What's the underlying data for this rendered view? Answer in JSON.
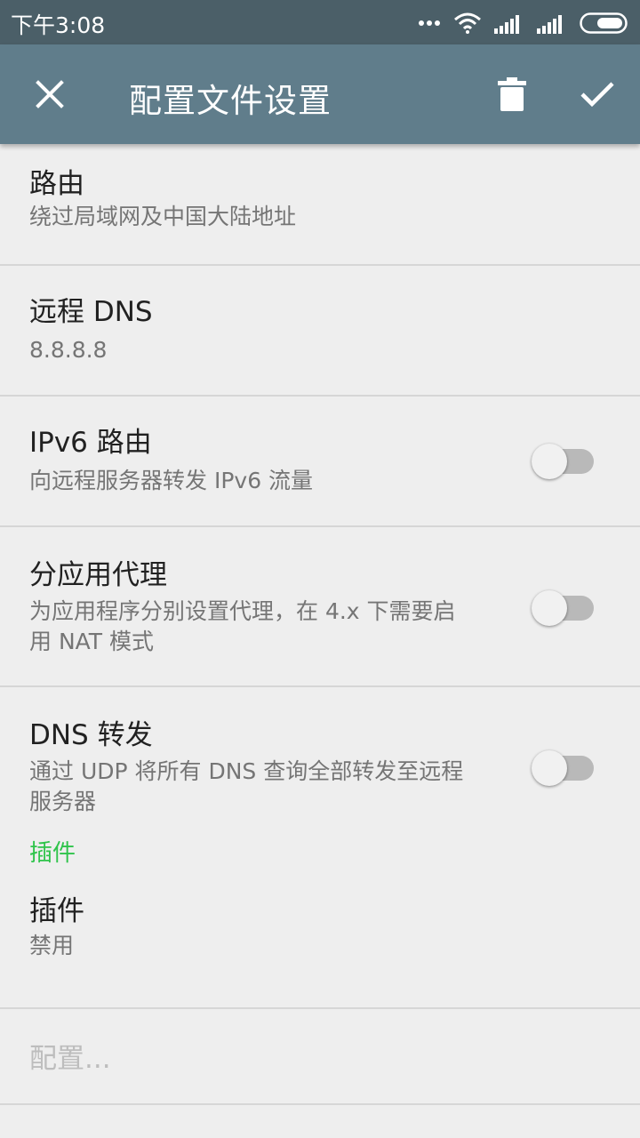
{
  "status_bar": {
    "time": "下午3:08",
    "icons": [
      "more-dots-icon",
      "wifi-icon",
      "signal-icon",
      "signal-icon",
      "battery-icon"
    ]
  },
  "toolbar": {
    "title": "配置文件设置",
    "close_icon": "close-icon",
    "delete_icon": "delete-icon",
    "check_icon": "check-icon",
    "background": "#607d8b"
  },
  "prefs": [
    {
      "title": "路由",
      "summary": "绕过局域网及中国大陆地址"
    },
    {
      "title": "远程 DNS",
      "summary": "8.8.8.8"
    },
    {
      "title": "IPv6 路由",
      "summary": "向远程服务器转发 IPv6 流量",
      "switch_on": false
    },
    {
      "title": "分应用代理",
      "summary_line1": "为应用程序分别设置代理，在 4.x 下需要启",
      "summary_line2": "用 NAT 模式",
      "switch_on": false
    },
    {
      "title": "DNS 转发",
      "summary_line1": "通过 UDP 将所有 DNS 查询全部转发至远程",
      "summary_line2": "服务器",
      "switch_on": false
    }
  ],
  "plugin_section": {
    "category": "插件",
    "plugin_title": "插件",
    "plugin_summary": "禁用",
    "configure": "配置..."
  },
  "colors": {
    "accent": "#2fc44b",
    "status_bar": "#4b5f68",
    "background": "#eeeeee"
  }
}
